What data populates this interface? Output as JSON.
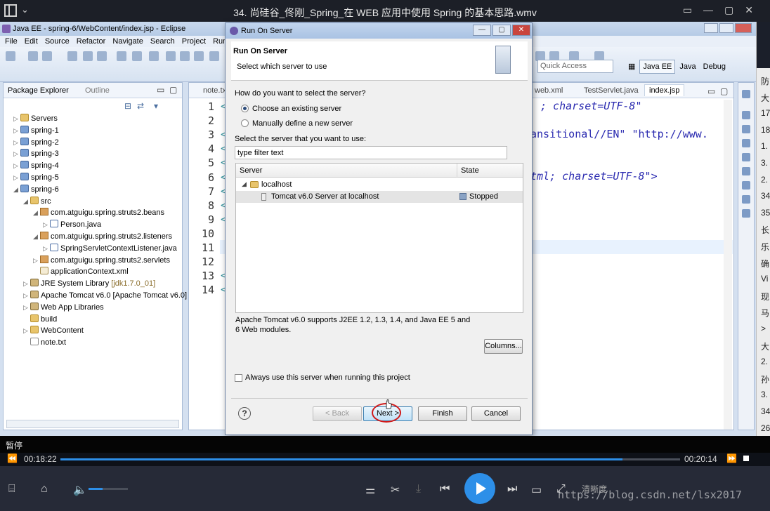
{
  "player": {
    "title": "34. 尚硅谷_佟刚_Spring_在 WEB 应用中使用 Spring 的基本思路.wmv",
    "status": "暂停",
    "time_current": "00:18:22",
    "time_total": "00:20:14",
    "progress": 0.9075,
    "volume": 0.35,
    "clarity_label": "清晰度",
    "watermark": "https://blog.csdn.net/lsx2017"
  },
  "right_strip": {
    "rows": [
      "防",
      "大",
      "17",
      "18",
      "1.",
      "3.",
      "2.",
      "34",
      "35",
      "长",
      "乐",
      "确",
      "Vi",
      "现",
      "马",
      ">",
      "大",
      "2.",
      "孙",
      "3.",
      "34",
      "26"
    ]
  },
  "eclipse": {
    "window_title": "Java EE - spring-6/WebContent/index.jsp - Eclipse",
    "menu": [
      "File",
      "Edit",
      "Source",
      "Refactor",
      "Navigate",
      "Search",
      "Project",
      "Run"
    ],
    "quick_access_placeholder": "Quick Access",
    "perspectives": [
      "Java EE",
      "Java",
      "Debug"
    ],
    "package_explorer": {
      "tab_label": "Package Explorer",
      "outline_label": "Outline",
      "tree": [
        {
          "label": "Servers",
          "indent": 0,
          "twisty": "▷",
          "icon": "folder"
        },
        {
          "label": "spring-1",
          "indent": 0,
          "twisty": "▷",
          "icon": "proj"
        },
        {
          "label": "spring-2",
          "indent": 0,
          "twisty": "▷",
          "icon": "proj"
        },
        {
          "label": "spring-3",
          "indent": 0,
          "twisty": "▷",
          "icon": "proj"
        },
        {
          "label": "spring-4",
          "indent": 0,
          "twisty": "▷",
          "icon": "proj"
        },
        {
          "label": "spring-5",
          "indent": 0,
          "twisty": "▷",
          "icon": "proj"
        },
        {
          "label": "spring-6",
          "indent": 0,
          "twisty": "◢",
          "icon": "proj"
        },
        {
          "label": "src",
          "indent": 1,
          "twisty": "◢",
          "icon": "folder"
        },
        {
          "label": "com.atguigu.spring.struts2.beans",
          "indent": 2,
          "twisty": "◢",
          "icon": "pkg"
        },
        {
          "label": "Person.java",
          "indent": 3,
          "twisty": "▷",
          "icon": "java"
        },
        {
          "label": "com.atguigu.spring.struts2.listeners",
          "indent": 2,
          "twisty": "◢",
          "icon": "pkg"
        },
        {
          "label": "SpringServletContextListener.java",
          "indent": 3,
          "twisty": "▷",
          "icon": "java"
        },
        {
          "label": "com.atguigu.spring.struts2.servlets",
          "indent": 2,
          "twisty": "▷",
          "icon": "pkg"
        },
        {
          "label": "applicationContext.xml",
          "indent": 2,
          "twisty": "",
          "icon": "xml"
        },
        {
          "label": "JRE System Library",
          "extra": "[jdk1.7.0_01]",
          "indent": 1,
          "twisty": "▷",
          "icon": "lib"
        },
        {
          "label": "Apache Tomcat v6.0 [Apache Tomcat v6.0]",
          "indent": 1,
          "twisty": "▷",
          "icon": "lib"
        },
        {
          "label": "Web App Libraries",
          "indent": 1,
          "twisty": "▷",
          "icon": "lib"
        },
        {
          "label": "build",
          "indent": 1,
          "twisty": "",
          "icon": "folder"
        },
        {
          "label": "WebContent",
          "indent": 1,
          "twisty": "▷",
          "icon": "folder"
        },
        {
          "label": "note.txt",
          "indent": 1,
          "twisty": "",
          "icon": "txt"
        }
      ]
    },
    "editor": {
      "tabs": [
        "note.txt",
        "web.xml",
        "TestServlet.java",
        "index.jsp"
      ],
      "line_numbers": [
        "1",
        "2",
        "3",
        "4",
        "5",
        "6",
        "7",
        "8",
        "9",
        "10",
        "11",
        "12",
        "13",
        "14"
      ],
      "code_fragments": [
        {
          "text": "; charset=UTF-8\"",
          "line": 1
        },
        {
          "text": "ansitional//EN\" \"http://www.",
          "line": 3
        },
        {
          "text": "tml; charset=UTF-8\">",
          "line": 6
        }
      ]
    }
  },
  "dialog": {
    "title": "Run On Server",
    "heading": "Run On Server",
    "subheading": "Select which server to use",
    "question": "How do you want to select the server?",
    "option_existing": "Choose an existing server",
    "option_new": "Manually define a new server",
    "select_label": "Select the server that you want to use:",
    "filter_value": "type filter text",
    "table": {
      "col_server": "Server",
      "col_state": "State",
      "rows": [
        {
          "name": "localhost",
          "state": ""
        },
        {
          "name": "Tomcat v6.0 Server at localhost",
          "state": "Stopped"
        }
      ]
    },
    "description": "Apache Tomcat v6.0 supports J2EE 1.2, 1.3, 1.4, and Java EE 5 and 6 Web modules.",
    "columns_button": "Columns...",
    "always_use_label": "Always use this server when running this project",
    "buttons": {
      "back": "< Back",
      "next": "Next >",
      "finish": "Finish",
      "cancel": "Cancel"
    }
  }
}
